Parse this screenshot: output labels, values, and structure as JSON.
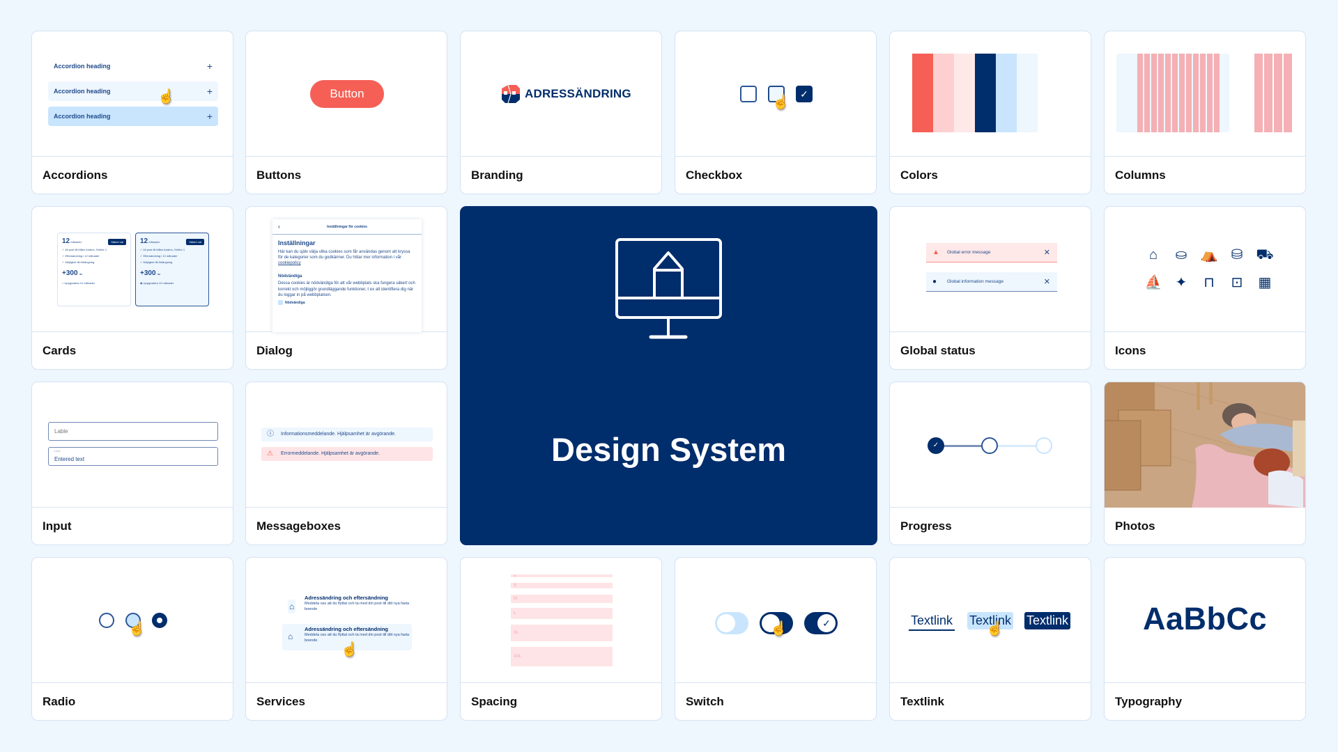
{
  "colors": {
    "background": "#eef6fe",
    "navy": "#002d6b",
    "coral": "#f55f55",
    "light_blue": "#c8e5fd",
    "pale_blue": "#eef6fe",
    "pink": "#fecfd0",
    "pale_pink": "#fee8e8"
  },
  "cards": {
    "accordions": {
      "label": "Accordions",
      "items": [
        {
          "heading": "Accordion heading",
          "icon": "plus-icon",
          "state": "default"
        },
        {
          "heading": "Accordion heading",
          "icon": "plus-icon",
          "state": "hover"
        },
        {
          "heading": "Accordion heading",
          "icon": "plus-icon",
          "state": "active"
        }
      ]
    },
    "buttons": {
      "label": "Buttons",
      "button_label": "Button"
    },
    "branding": {
      "label": "Branding",
      "logo_text": "ADRESSÄNDRING"
    },
    "checkbox": {
      "label": "Checkbox",
      "states": [
        "unchecked",
        "hover",
        "checked"
      ]
    },
    "colors": {
      "label": "Colors",
      "swatches": [
        "#f55f55",
        "#fecfd0",
        "#fee8e8",
        "#002d6b",
        "#c8e5fd",
        "#eef6fe"
      ]
    },
    "columns": {
      "label": "Columns",
      "wide_columns": 12,
      "narrow_columns": 4
    },
    "cards": {
      "label": "Cards",
      "items": [
        {
          "months": "12",
          "unit": "månader",
          "tag": "Säkert val",
          "features": [
            "All post till Måns Anders, Ströbe 1",
            "Eftersändning i 12 månader",
            "Möjlighet till förlängning"
          ],
          "price": "+300",
          "currency": "kr",
          "upgrade": "Uppgradera 12 månader",
          "selected": false
        },
        {
          "months": "12",
          "unit": "månader",
          "tag": "Säkert val",
          "features": [
            "All post till Måns Anders, Ströbe 1",
            "Eftersändning i 12 månader",
            "Möjlighet till förlängning"
          ],
          "price": "+300",
          "currency": "kr",
          "upgrade": "Uppgradera 12 månader",
          "selected": true
        }
      ]
    },
    "dialog": {
      "label": "Dialog",
      "header": "Inställningar för cookies",
      "title": "Inställningar",
      "intro": "Här kan du själv välja vilka cookies som får användas genom att kryssa för de kategorier som du godkänner. Du hittar mer information i vår",
      "link": "cookiepolicy",
      "section_title": "Nödvändiga",
      "section_text": "Dessa cookies är nödvändiga för att vår webbplats ska fungera säkert och korrekt och möjliggör grundläggande funktioner, t ex att identifiera dig när du loggar in på webbplatsen.",
      "checkbox_label": "Nödvändiga"
    },
    "global_status": {
      "label": "Global status",
      "error": "Global error message",
      "info": "Global information message"
    },
    "icons": {
      "label": "Icons",
      "items": [
        "house-icon",
        "armchair-icon",
        "office-chair-icon",
        "backpack-icon",
        "caravan-icon",
        "sailboat-icon",
        "bird-icon",
        "unlocked-icon",
        "lock-icon",
        "building-icon"
      ]
    },
    "input": {
      "label": "Input",
      "placeholder": "Lable",
      "filled_label": "Lable",
      "filled_value": "Entered text"
    },
    "messageboxes": {
      "label": "Messageboxes",
      "info": "Informationsmeddelande. Hjälpsamhet är avgörande.",
      "error": "Errormeddelande. Hjälpsamhet är avgörande."
    },
    "feature": {
      "title": "Design System",
      "icon": "monitor-pen-icon"
    },
    "progress": {
      "label": "Progress",
      "steps": 3,
      "completed_steps": 1,
      "current_step": 2
    },
    "photos": {
      "label": "Photos"
    },
    "radio": {
      "label": "Radio",
      "states": [
        "unselected",
        "hover",
        "selected"
      ]
    },
    "services": {
      "label": "Services",
      "items": [
        {
          "title": "Adressändring och eftersändning",
          "text": "Meddela oss att du flyttat och ta med din post till ditt nya fasta boende"
        },
        {
          "title": "Adressändring och eftersändning",
          "text": "Meddela oss att du flyttat och ta med din post till ditt nya fasta boende"
        }
      ]
    },
    "spacing": {
      "label": "Spacing",
      "sizes": [
        "XS",
        "S",
        "M",
        "L",
        "XL",
        "XXL"
      ]
    },
    "switch": {
      "label": "Switch",
      "states": [
        "off",
        "hover",
        "on"
      ]
    },
    "textlink": {
      "label": "Textlink",
      "link_text": "Textlink"
    },
    "typography": {
      "label": "Typography",
      "sample": "AaBbCc"
    }
  }
}
